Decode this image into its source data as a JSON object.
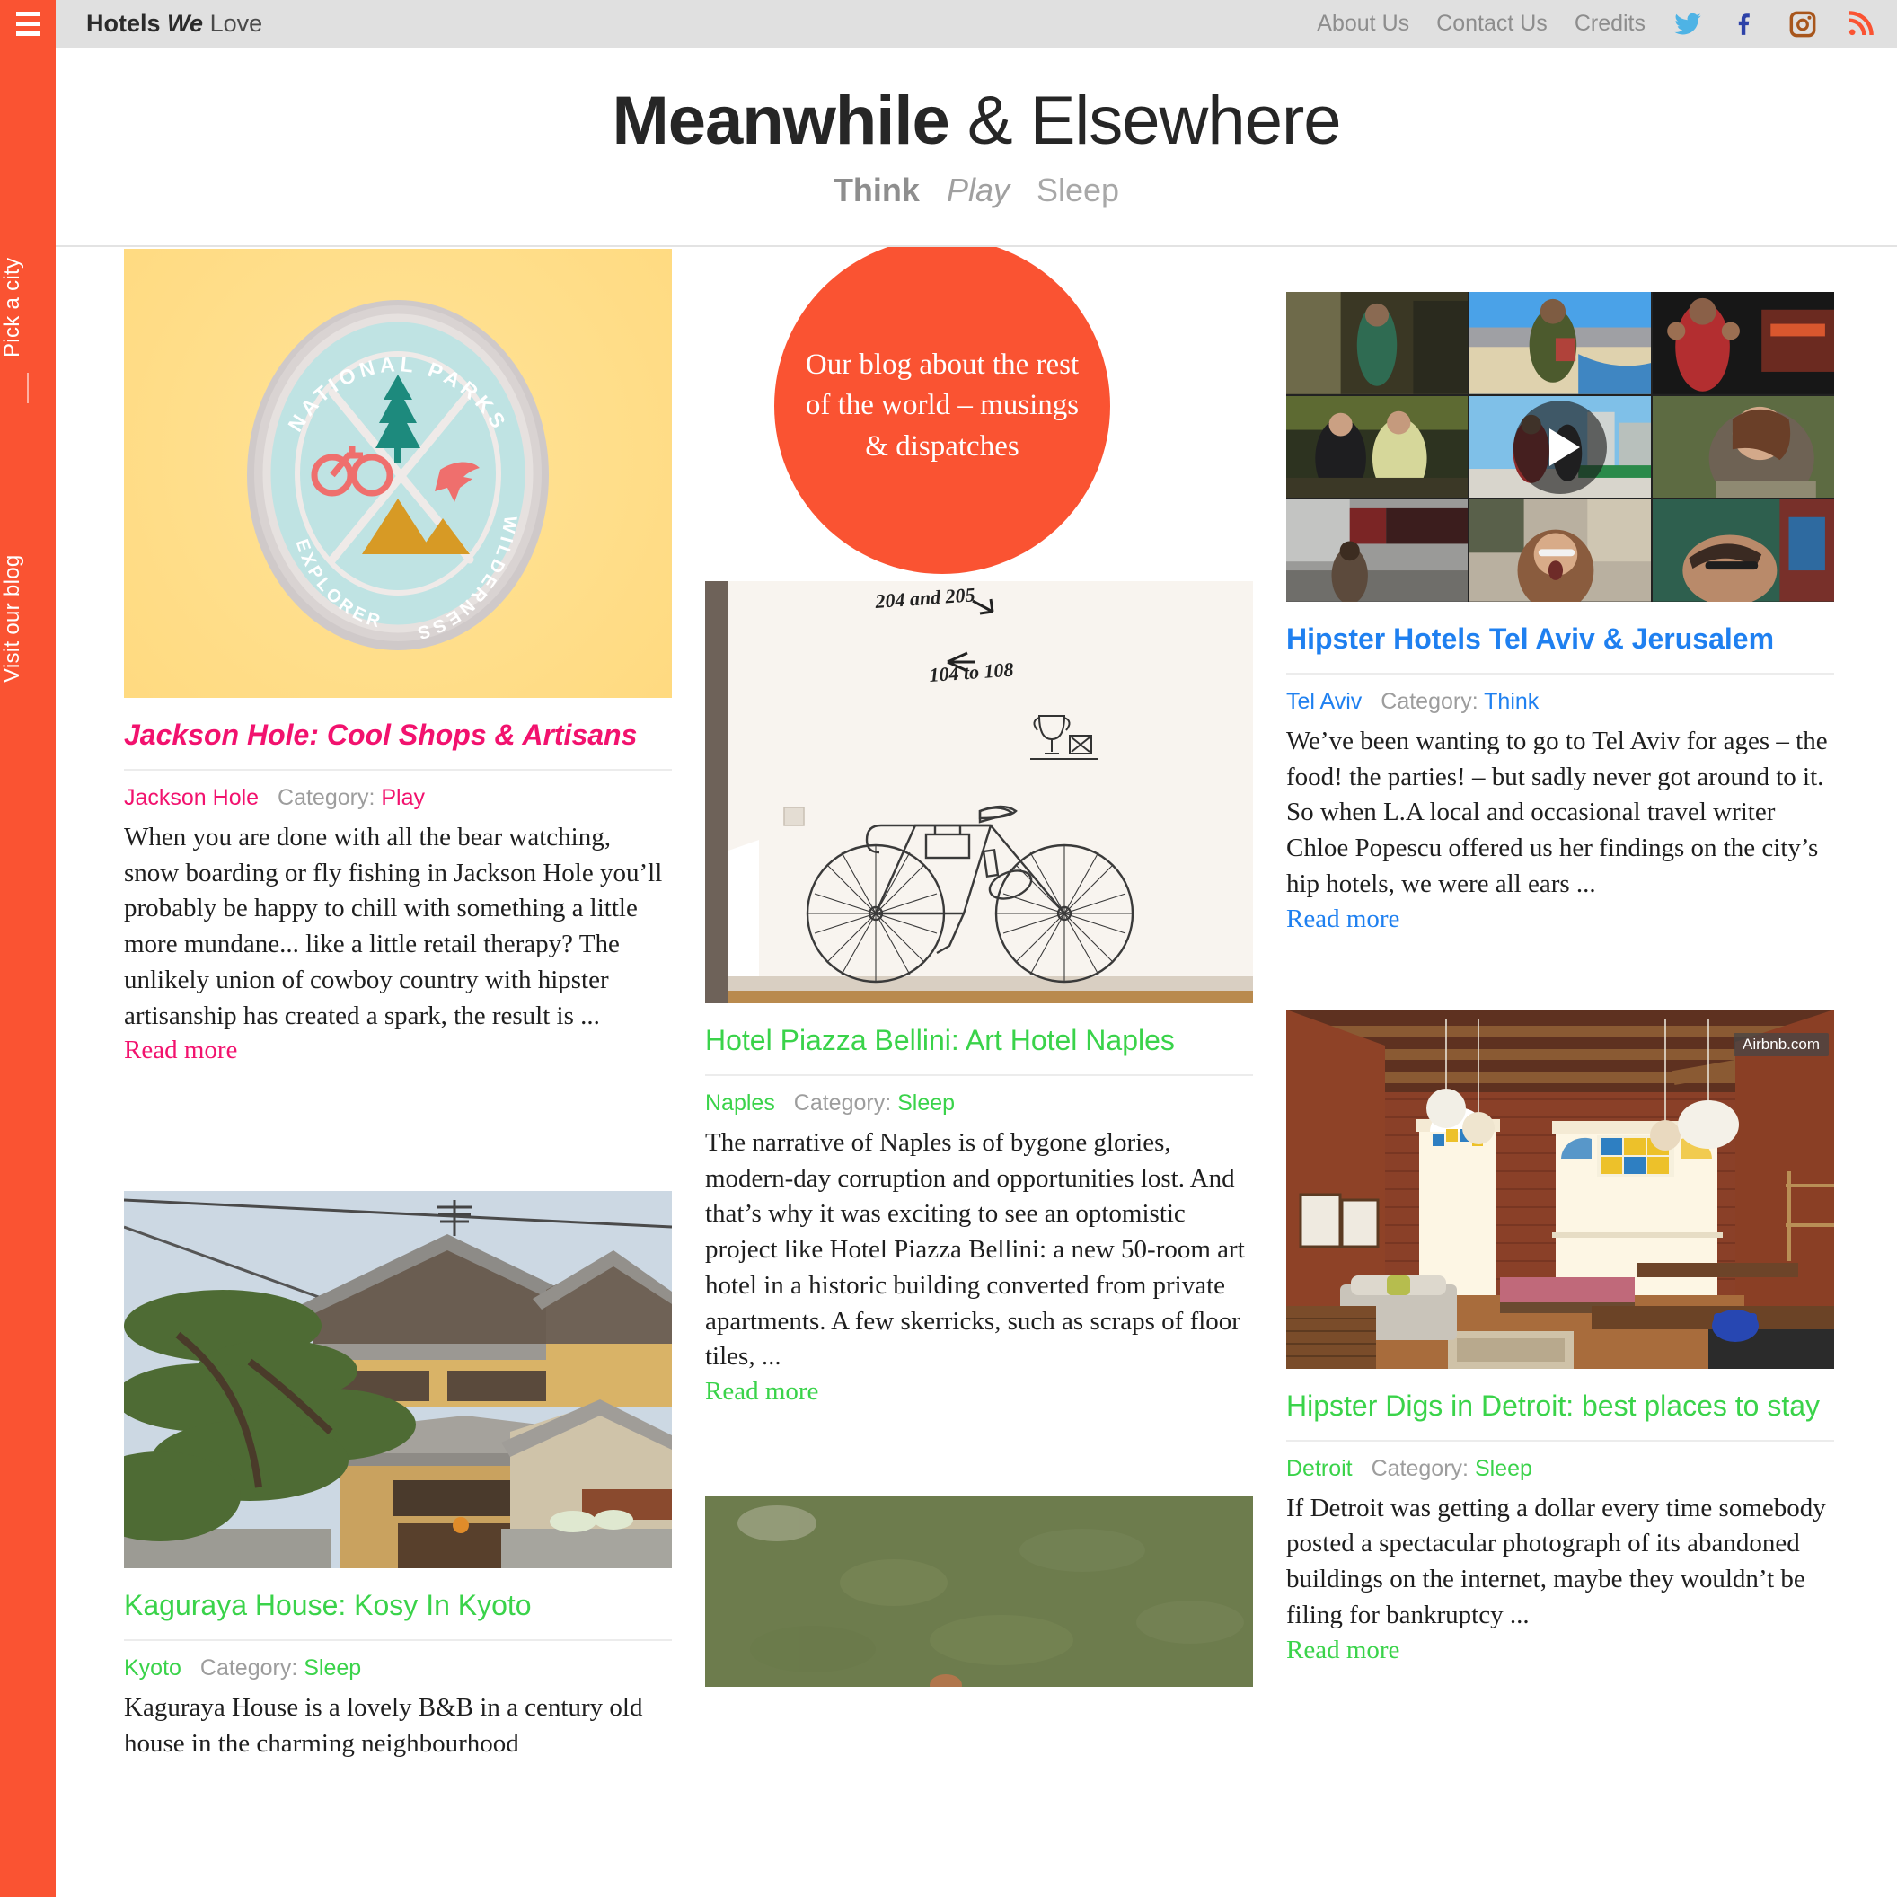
{
  "rail": {
    "menu_icon": "hamburger-menu-icon",
    "pick_city": "Pick a city",
    "visit_blog": "Visit our blog",
    "color": "#fa5332"
  },
  "topbar": {
    "logo": {
      "word1": "Hotels",
      "word2": "We",
      "word3": "Love"
    },
    "nav": [
      {
        "label": "About Us"
      },
      {
        "label": "Contact Us"
      },
      {
        "label": "Credits"
      }
    ],
    "social": [
      {
        "name": "twitter-icon",
        "color": "#4eb3e5"
      },
      {
        "name": "facebook-icon",
        "color": "#2d42a8"
      },
      {
        "name": "instagram-icon",
        "color": "#a8561c"
      },
      {
        "name": "rss-icon",
        "color": "#fa5332"
      }
    ],
    "bg": "#e0e0e0"
  },
  "masthead": {
    "title_bold": "Meanwhile",
    "title_light": "& Elsewhere",
    "tagline": {
      "think": "Think",
      "play": "Play",
      "sleep": "Sleep"
    }
  },
  "badge": {
    "text": "Our blog about the rest of the world – musings & dispatches"
  },
  "colors": {
    "play_pink": "#f2126e",
    "think_blue": "#1f80f0",
    "sleep_green": "#3ad34a",
    "muted_gray": "#9d9d9d"
  },
  "cards": {
    "jackson": {
      "image_alt": "national-parks-explorer-wilderness-patch-on-yellow",
      "patch_text": {
        "top": "NATIONAL PARKS",
        "bottom_left": "EXPLORER",
        "bottom_right": "WILDERNESS"
      },
      "title": "Jackson Hole: Cool Shops & Artisans",
      "place": "Jackson Hole",
      "cat_label": "Category:",
      "category": "Play",
      "body": "When you are done with all the bear watching, snow boarding or fly fishing in Jackson Hole you’ll probably be happy to chill with something a little more mundane... like a little retail therapy?  The unlikely union of cowboy country with hipster artisanship has created a spark, the result is ...",
      "read_more": "Read more"
    },
    "kyoto": {
      "image_alt": "traditional-japanese-house-tiled-roof-kyoto",
      "title": "Kaguraya House: Kosy In Kyoto",
      "place": "Kyoto",
      "cat_label": "Category:",
      "category": "Sleep",
      "body": "Kaguraya House is a lovely B&B in a century old house in the charming neighbourhood",
      "read_more": "Read more"
    },
    "naples": {
      "image_alt": "white-wall-with-drawn-bicycle-mural",
      "wall_text_1": "204 and 205",
      "wall_text_2": "104 to 108",
      "title": "Hotel Piazza Bellini: Art Hotel Naples",
      "place": "Naples",
      "cat_label": "Category:",
      "category": "Sleep",
      "body": "The narrative of Naples is of bygone glories, modern-day corruption and opportunities lost. And that’s why it was exciting to see an optomistic project like Hotel Piazza Bellini: a new 50-room art hotel  in a historic building converted from private apartments. A few skerricks, such as scraps of floor tiles, ...",
      "read_more": "Read more"
    },
    "grass": {
      "image_alt": "grass-field-aerial"
    },
    "telaviv": {
      "image_alt": "video-montage-grid-tel-aviv-people",
      "play_icon": "play-button-icon",
      "title": "Hipster Hotels Tel Aviv & Jerusalem",
      "place": "Tel Aviv",
      "cat_label": "Category:",
      "category": "Think",
      "body": "We’ve been wanting to go to Tel Aviv for ages – the food! the parties! – but sadly never got around to it. So when L.A local and occasional travel writer Chloe Popescu offered us her findings on the city’s hip hotels, we were all ears ...",
      "read_more": "Read more"
    },
    "detroit": {
      "image_alt": "brick-loft-interior-with-stained-glass-windows",
      "watermark": "Airbnb.com",
      "title": "Hipster Digs in Detroit: best places to stay",
      "place": "Detroit",
      "cat_label": "Category:",
      "category": "Sleep",
      "body": "If Detroit was getting a dollar every time somebody posted a spectacular photograph of its abandoned buildings on the internet, maybe they wouldn’t be filing for bankruptcy ...",
      "read_more": "Read more"
    }
  }
}
